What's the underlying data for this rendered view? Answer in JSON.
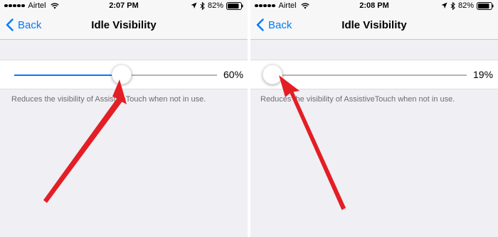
{
  "panels": [
    {
      "status": {
        "carrier": "Airtel",
        "time": "2:07 PM",
        "battery": "82%"
      },
      "nav": {
        "back_label": "Back",
        "title": "Idle Visibility"
      },
      "slider": {
        "value_label": "60%",
        "fraction": 0.53
      },
      "note": "Reduces the visibility of AssistiveTouch when not in use."
    },
    {
      "status": {
        "carrier": "Airtel",
        "time": "2:08 PM",
        "battery": "82%"
      },
      "nav": {
        "back_label": "Back",
        "title": "Idle Visibility"
      },
      "slider": {
        "value_label": "19%",
        "fraction": 0.045
      },
      "note": "Reduces the visibility of AssistiveTouch when not in use."
    }
  ],
  "colors": {
    "accent": "#007aff",
    "annotation_arrow": "#e31e24"
  }
}
